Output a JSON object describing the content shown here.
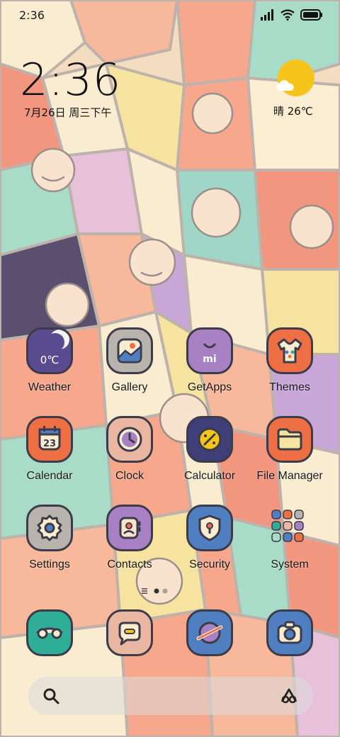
{
  "status_bar": {
    "time": "2:36",
    "icons": [
      "signal-icon",
      "wifi-icon",
      "battery-icon"
    ]
  },
  "clock_widget": {
    "time": "2:36",
    "date": "7月26日 周三下午"
  },
  "weather_widget": {
    "condition_temp": "晴 26℃",
    "icon": "sun-cloud-icon"
  },
  "apps": [
    {
      "label": "Weather",
      "icon": "weather-app-icon",
      "badge_text": "0℃",
      "color": "#5a4a90"
    },
    {
      "label": "Gallery",
      "icon": "gallery-icon",
      "color": "#b9b3ad"
    },
    {
      "label": "GetApps",
      "icon": "getapps-icon",
      "badge_text": "mi",
      "color": "#a881c4"
    },
    {
      "label": "Themes",
      "icon": "themes-icon",
      "color": "#ef6f45"
    },
    {
      "label": "Calendar",
      "icon": "calendar-icon",
      "badge_text": "23",
      "color": "#ef6f45"
    },
    {
      "label": "Clock",
      "icon": "clock-icon",
      "color": "#e9b7a2"
    },
    {
      "label": "Calculator",
      "icon": "calculator-icon",
      "color": "#3e3f78"
    },
    {
      "label": "File Manager",
      "icon": "folder-icon",
      "color": "#ef6f45"
    },
    {
      "label": "Settings",
      "icon": "gear-icon",
      "color": "#b9b3ad"
    },
    {
      "label": "Contacts",
      "icon": "contacts-icon",
      "color": "#a881c4"
    },
    {
      "label": "Security",
      "icon": "shield-icon",
      "color": "#4f7fc0"
    },
    {
      "label": "System",
      "icon": "folder-system-icon",
      "color": "#d8cfc3"
    }
  ],
  "dock": [
    {
      "icon": "phone-icon",
      "color": "#2fae97"
    },
    {
      "icon": "message-icon",
      "color": "#e9b7a2"
    },
    {
      "icon": "browser-icon",
      "color": "#4f7fc0"
    },
    {
      "icon": "camera-icon",
      "color": "#4f7fc0"
    }
  ],
  "page_indicator": {
    "pages": 2,
    "current": 1
  },
  "search_bar": {
    "left_icon": "search-icon",
    "right_icon": "assistant-icon"
  }
}
